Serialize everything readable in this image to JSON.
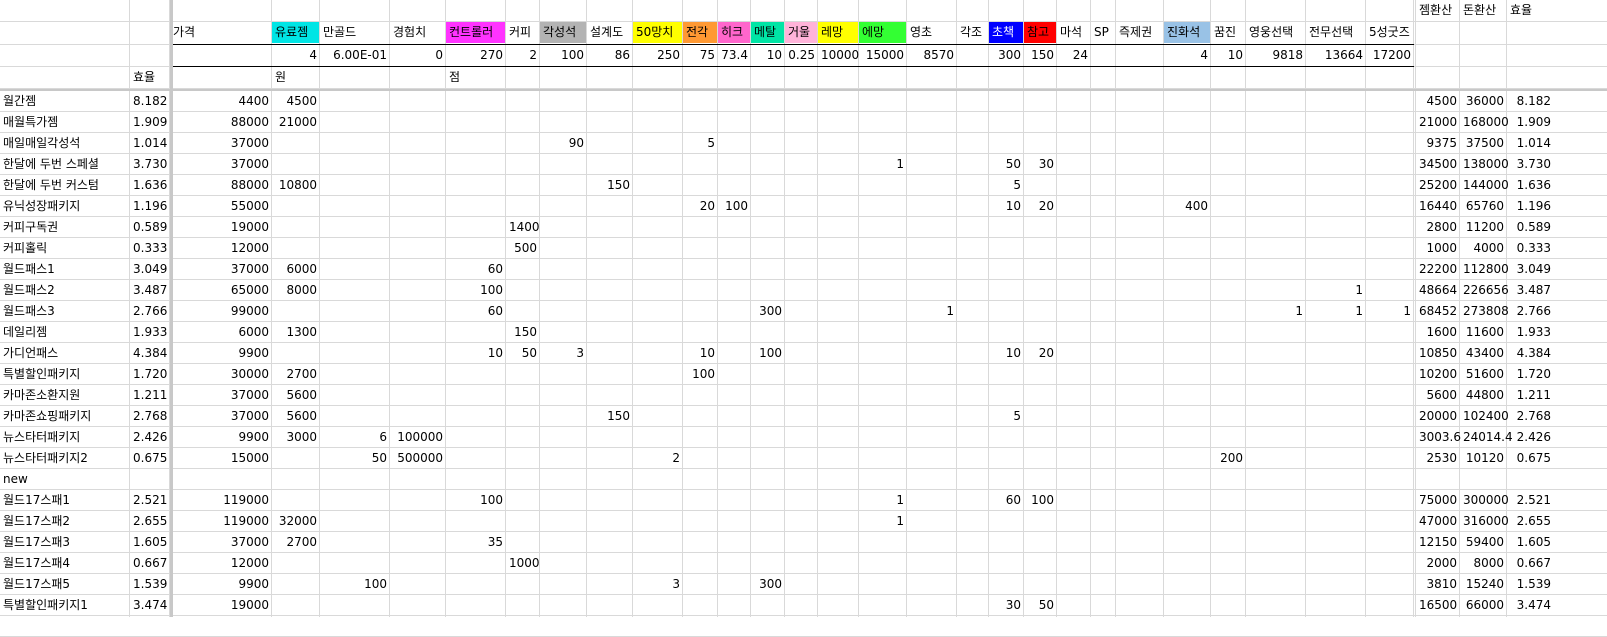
{
  "columns": [
    {
      "key": "name",
      "w": 130
    },
    {
      "key": "eff",
      "w": 40
    },
    {
      "key": "price",
      "w": 102
    },
    {
      "key": "yuryojam",
      "w": 48
    },
    {
      "key": "mangold",
      "w": 70
    },
    {
      "key": "exp",
      "w": 56
    },
    {
      "key": "controller",
      "w": 60
    },
    {
      "key": "coffee",
      "w": 34
    },
    {
      "key": "gakseong",
      "w": 47
    },
    {
      "key": "seolgye",
      "w": 46
    },
    {
      "key": "manggchi50",
      "w": 50
    },
    {
      "key": "jeongak",
      "w": 35
    },
    {
      "key": "hike",
      "w": 33
    },
    {
      "key": "metal",
      "w": 34
    },
    {
      "key": "geoul",
      "w": 33
    },
    {
      "key": "remang",
      "w": 41
    },
    {
      "key": "yemang",
      "w": 48
    },
    {
      "key": "yeongcho",
      "w": 50
    },
    {
      "key": "gakjo",
      "w": 32
    },
    {
      "key": "chochaek",
      "w": 35
    },
    {
      "key": "chamgo",
      "w": 33
    },
    {
      "key": "maseok",
      "w": 34
    },
    {
      "key": "sp",
      "w": 25
    },
    {
      "key": "jeukjegwon",
      "w": 48
    },
    {
      "key": "jinhwaseok",
      "w": 47
    },
    {
      "key": "kkumjin",
      "w": 35
    },
    {
      "key": "yeongung",
      "w": 60
    },
    {
      "key": "jeonmu",
      "w": 60
    },
    {
      "key": "goods5",
      "w": 48
    },
    {
      "key": "empty",
      "w": 2
    },
    {
      "key": "jam_conv",
      "w": 44
    },
    {
      "key": "don_conv",
      "w": 47
    },
    {
      "key": "eff2",
      "w": 47
    }
  ],
  "header_row1": {
    "jam_conv": "젬환산",
    "don_conv": "돈환산",
    "eff2": "효율"
  },
  "header_row2": {
    "price": "가격",
    "yuryojam": "유료젬",
    "mangold": "만골드",
    "exp": "경험치",
    "controller": "컨트롤러",
    "coffee": "커피",
    "gakseong": "각성석",
    "seolgye": "설계도",
    "manggchi50": "50망치",
    "jeongak": "전각",
    "hike": "히크",
    "metal": "메탈",
    "geoul": "거울",
    "remang": "레망",
    "yemang": "에망",
    "yeongcho": "영초",
    "gakjo": "각조",
    "chochaek": "초책",
    "chamgo": "참고",
    "maseok": "마석",
    "sp": "SP",
    "jeukjegwon": "즉제권",
    "jinhwaseok": "진화석",
    "kkumjin": "꿈진",
    "yeongung": "영웅선택",
    "jeonmu": "전무선택",
    "goods5": "5성굿즈"
  },
  "header_colors": {
    "yuryojam": "#00e5e5",
    "controller": "#ff33ff",
    "gakseong": "#b3b3b3",
    "manggchi50": "#ffff00",
    "jeongak": "#ff9933",
    "hike": "#ff66cc",
    "metal": "#00e5a5",
    "geoul": "#ffb3d9",
    "remang": "#ffff00",
    "yemang": "#33ff33",
    "chochaek": "#0000ff",
    "chamgo": "#ff0000",
    "jinhwaseok": "#99c2e6"
  },
  "header_row3": {
    "yuryojam": "4",
    "mangold": "6.00E-01",
    "exp": "0",
    "controller": "270",
    "coffee": "2",
    "gakseong": "100",
    "seolgye": "86",
    "manggchi50": "250",
    "jeongak": "75",
    "hike": "73.4",
    "metal": "10",
    "geoul": "0.25",
    "remang": "10000",
    "yemang": "15000",
    "yeongcho": "8570",
    "chochaek": "300",
    "chamgo": "150",
    "maseok": "24",
    "jinhwaseok": "4",
    "kkumjin": "10",
    "yeongung": "9818",
    "jeonmu": "13664",
    "goods5": "17200"
  },
  "header_row4": {
    "eff": "효율",
    "yuryojam": "원",
    "controller": "점"
  },
  "rows": [
    {
      "name": "월간젬",
      "eff": "8.182",
      "price": "4400",
      "yuryojam": "4500",
      "jam_conv": "4500",
      "don_conv": "36000",
      "eff2": "8.182"
    },
    {
      "name": "매월특가젬",
      "eff": "1.909",
      "price": "88000",
      "yuryojam": "21000",
      "jam_conv": "21000",
      "don_conv": "168000",
      "eff2": "1.909"
    },
    {
      "name": "매일매일각성석",
      "eff": "1.014",
      "price": "37000",
      "gakseong": "90",
      "jeongak": "5",
      "jam_conv": "9375",
      "don_conv": "37500",
      "eff2": "1.014"
    },
    {
      "name": "한달에 두번 스페셜",
      "eff": "3.730",
      "price": "37000",
      "yemang": "1",
      "chochaek": "50",
      "chamgo": "30",
      "jam_conv": "34500",
      "don_conv": "138000",
      "eff2": "3.730"
    },
    {
      "name": "한달에 두번 커스텀",
      "eff": "1.636",
      "price": "88000",
      "yuryojam": "10800",
      "seolgye": "150",
      "chochaek": "5",
      "jam_conv": "25200",
      "don_conv": "144000",
      "eff2": "1.636"
    },
    {
      "name": "유닉성장패키지",
      "eff": "1.196",
      "price": "55000",
      "jeongak": "20",
      "hike": "100",
      "chochaek": "10",
      "chamgo": "20",
      "jinhwaseok": "400",
      "jam_conv": "16440",
      "don_conv": "65760",
      "eff2": "1.196"
    },
    {
      "name": "커피구독권",
      "eff": "0.589",
      "price": "19000",
      "coffee": "1400",
      "jam_conv": "2800",
      "don_conv": "11200",
      "eff2": "0.589"
    },
    {
      "name": "커피홀릭",
      "eff": "0.333",
      "price": "12000",
      "coffee": "500",
      "jam_conv": "1000",
      "don_conv": "4000",
      "eff2": "0.333"
    },
    {
      "name": "월드패스1",
      "eff": "3.049",
      "price": "37000",
      "yuryojam": "6000",
      "controller": "60",
      "jam_conv": "22200",
      "don_conv": "112800",
      "eff2": "3.049"
    },
    {
      "name": "월드패스2",
      "eff": "3.487",
      "price": "65000",
      "yuryojam": "8000",
      "controller": "100",
      "jeonmu": "1",
      "jam_conv": "48664",
      "don_conv": "226656",
      "eff2": "3.487"
    },
    {
      "name": "월드패스3",
      "eff": "2.766",
      "price": "99000",
      "controller": "60",
      "metal": "300",
      "yeongcho": "1",
      "yeongung": "1",
      "jeonmu": "1",
      "goods5": "1",
      "jam_conv": "68452",
      "don_conv": "273808",
      "eff2": "2.766"
    },
    {
      "name": "데일리젬",
      "eff": "1.933",
      "price": "6000",
      "yuryojam": "1300",
      "coffee": "150",
      "jam_conv": "1600",
      "don_conv": "11600",
      "eff2": "1.933"
    },
    {
      "name": "가디언패스",
      "eff": "4.384",
      "price": "9900",
      "controller": "10",
      "coffee": "50",
      "gakseong": "3",
      "jeongak": "10",
      "metal": "100",
      "chochaek": "10",
      "chamgo": "20",
      "jam_conv": "10850",
      "don_conv": "43400",
      "eff2": "4.384"
    },
    {
      "name": "특별할인패키지",
      "eff": "1.720",
      "price": "30000",
      "yuryojam": "2700",
      "jeongak": "100",
      "jam_conv": "10200",
      "don_conv": "51600",
      "eff2": "1.720"
    },
    {
      "name": "카마존소환지원",
      "eff": "1.211",
      "price": "37000",
      "yuryojam": "5600",
      "jam_conv": "5600",
      "don_conv": "44800",
      "eff2": "1.211"
    },
    {
      "name": "카마존쇼핑패키지",
      "eff": "2.768",
      "price": "37000",
      "yuryojam": "5600",
      "seolgye": "150",
      "chochaek": "5",
      "jam_conv": "20000",
      "don_conv": "102400",
      "eff2": "2.768"
    },
    {
      "name": "뉴스타터패키지",
      "eff": "2.426",
      "price": "9900",
      "yuryojam": "3000",
      "mangold": "6",
      "exp": "100000",
      "jam_conv": "3003.6",
      "don_conv": "24014.4",
      "eff2": "2.426"
    },
    {
      "name": "뉴스타터패키지2",
      "eff": "0.675",
      "price": "15000",
      "mangold": "50",
      "exp": "500000",
      "manggchi50": "2",
      "kkumjin": "200",
      "jam_conv": "2530",
      "don_conv": "10120",
      "eff2": "0.675"
    },
    {
      "name": "new"
    },
    {
      "name": "월드17스패1",
      "eff": "2.521",
      "price": "119000",
      "controller": "100",
      "yemang": "1",
      "chochaek": "60",
      "chamgo": "100",
      "jam_conv": "75000",
      "don_conv": "300000",
      "eff2": "2.521"
    },
    {
      "name": "월드17스패2",
      "eff": "2.655",
      "price": "119000",
      "yuryojam": "32000",
      "yemang": "1",
      "jam_conv": "47000",
      "don_conv": "316000",
      "eff2": "2.655"
    },
    {
      "name": "월드17스패3",
      "eff": "1.605",
      "price": "37000",
      "yuryojam": "2700",
      "controller": "35",
      "jam_conv": "12150",
      "don_conv": "59400",
      "eff2": "1.605"
    },
    {
      "name": "월드17스패4",
      "eff": "0.667",
      "price": "12000",
      "coffee": "1000",
      "jam_conv": "2000",
      "don_conv": "8000",
      "eff2": "0.667"
    },
    {
      "name": "월드17스패5",
      "eff": "1.539",
      "price": "9900",
      "mangold": "100",
      "manggchi50": "3",
      "metal": "300",
      "jam_conv": "3810",
      "don_conv": "15240",
      "eff2": "1.539"
    },
    {
      "name": "특별할인패키지1",
      "eff": "3.474",
      "price": "19000",
      "chochaek": "30",
      "chamgo": "50",
      "jam_conv": "16500",
      "don_conv": "66000",
      "eff2": "3.474"
    }
  ]
}
